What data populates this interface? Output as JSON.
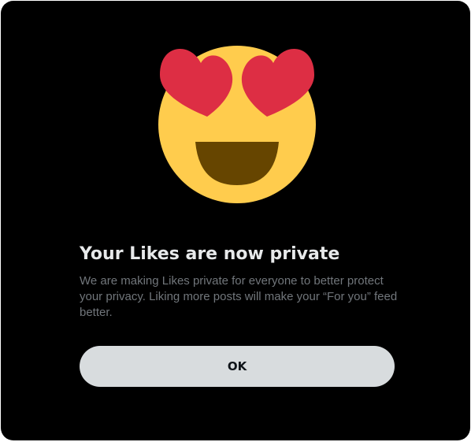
{
  "dialog": {
    "emoji": "smiling-face-with-heart-eyes-icon",
    "title": "Your Likes are now private",
    "body": "We are making Likes private for everyone to better protect your privacy. Liking more posts will make your “For you” feed better.",
    "ok_label": "OK"
  },
  "colors": {
    "background": "#000000",
    "title": "#E7E9EA",
    "body_text": "#71767B",
    "button_bg": "#D8DCDE",
    "button_text": "#0F1419",
    "emoji_face": "#FFCC4D",
    "emoji_hearts": "#DD2E44",
    "emoji_mouth": "#664500"
  }
}
